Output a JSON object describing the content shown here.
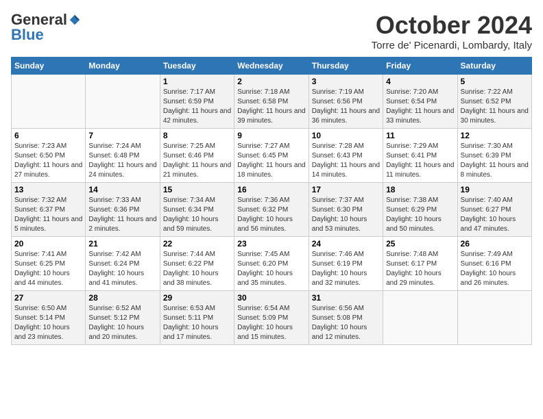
{
  "logo": {
    "general": "General",
    "blue": "Blue"
  },
  "header": {
    "month": "October 2024",
    "location": "Torre de' Picenardi, Lombardy, Italy"
  },
  "weekdays": [
    "Sunday",
    "Monday",
    "Tuesday",
    "Wednesday",
    "Thursday",
    "Friday",
    "Saturday"
  ],
  "weeks": [
    [
      {
        "day": "",
        "info": ""
      },
      {
        "day": "",
        "info": ""
      },
      {
        "day": "1",
        "info": "Sunrise: 7:17 AM\nSunset: 6:59 PM\nDaylight: 11 hours and 42 minutes."
      },
      {
        "day": "2",
        "info": "Sunrise: 7:18 AM\nSunset: 6:58 PM\nDaylight: 11 hours and 39 minutes."
      },
      {
        "day": "3",
        "info": "Sunrise: 7:19 AM\nSunset: 6:56 PM\nDaylight: 11 hours and 36 minutes."
      },
      {
        "day": "4",
        "info": "Sunrise: 7:20 AM\nSunset: 6:54 PM\nDaylight: 11 hours and 33 minutes."
      },
      {
        "day": "5",
        "info": "Sunrise: 7:22 AM\nSunset: 6:52 PM\nDaylight: 11 hours and 30 minutes."
      }
    ],
    [
      {
        "day": "6",
        "info": "Sunrise: 7:23 AM\nSunset: 6:50 PM\nDaylight: 11 hours and 27 minutes."
      },
      {
        "day": "7",
        "info": "Sunrise: 7:24 AM\nSunset: 6:48 PM\nDaylight: 11 hours and 24 minutes."
      },
      {
        "day": "8",
        "info": "Sunrise: 7:25 AM\nSunset: 6:46 PM\nDaylight: 11 hours and 21 minutes."
      },
      {
        "day": "9",
        "info": "Sunrise: 7:27 AM\nSunset: 6:45 PM\nDaylight: 11 hours and 18 minutes."
      },
      {
        "day": "10",
        "info": "Sunrise: 7:28 AM\nSunset: 6:43 PM\nDaylight: 11 hours and 14 minutes."
      },
      {
        "day": "11",
        "info": "Sunrise: 7:29 AM\nSunset: 6:41 PM\nDaylight: 11 hours and 11 minutes."
      },
      {
        "day": "12",
        "info": "Sunrise: 7:30 AM\nSunset: 6:39 PM\nDaylight: 11 hours and 8 minutes."
      }
    ],
    [
      {
        "day": "13",
        "info": "Sunrise: 7:32 AM\nSunset: 6:37 PM\nDaylight: 11 hours and 5 minutes."
      },
      {
        "day": "14",
        "info": "Sunrise: 7:33 AM\nSunset: 6:36 PM\nDaylight: 11 hours and 2 minutes."
      },
      {
        "day": "15",
        "info": "Sunrise: 7:34 AM\nSunset: 6:34 PM\nDaylight: 10 hours and 59 minutes."
      },
      {
        "day": "16",
        "info": "Sunrise: 7:36 AM\nSunset: 6:32 PM\nDaylight: 10 hours and 56 minutes."
      },
      {
        "day": "17",
        "info": "Sunrise: 7:37 AM\nSunset: 6:30 PM\nDaylight: 10 hours and 53 minutes."
      },
      {
        "day": "18",
        "info": "Sunrise: 7:38 AM\nSunset: 6:29 PM\nDaylight: 10 hours and 50 minutes."
      },
      {
        "day": "19",
        "info": "Sunrise: 7:40 AM\nSunset: 6:27 PM\nDaylight: 10 hours and 47 minutes."
      }
    ],
    [
      {
        "day": "20",
        "info": "Sunrise: 7:41 AM\nSunset: 6:25 PM\nDaylight: 10 hours and 44 minutes."
      },
      {
        "day": "21",
        "info": "Sunrise: 7:42 AM\nSunset: 6:24 PM\nDaylight: 10 hours and 41 minutes."
      },
      {
        "day": "22",
        "info": "Sunrise: 7:44 AM\nSunset: 6:22 PM\nDaylight: 10 hours and 38 minutes."
      },
      {
        "day": "23",
        "info": "Sunrise: 7:45 AM\nSunset: 6:20 PM\nDaylight: 10 hours and 35 minutes."
      },
      {
        "day": "24",
        "info": "Sunrise: 7:46 AM\nSunset: 6:19 PM\nDaylight: 10 hours and 32 minutes."
      },
      {
        "day": "25",
        "info": "Sunrise: 7:48 AM\nSunset: 6:17 PM\nDaylight: 10 hours and 29 minutes."
      },
      {
        "day": "26",
        "info": "Sunrise: 7:49 AM\nSunset: 6:16 PM\nDaylight: 10 hours and 26 minutes."
      }
    ],
    [
      {
        "day": "27",
        "info": "Sunrise: 6:50 AM\nSunset: 5:14 PM\nDaylight: 10 hours and 23 minutes."
      },
      {
        "day": "28",
        "info": "Sunrise: 6:52 AM\nSunset: 5:12 PM\nDaylight: 10 hours and 20 minutes."
      },
      {
        "day": "29",
        "info": "Sunrise: 6:53 AM\nSunset: 5:11 PM\nDaylight: 10 hours and 17 minutes."
      },
      {
        "day": "30",
        "info": "Sunrise: 6:54 AM\nSunset: 5:09 PM\nDaylight: 10 hours and 15 minutes."
      },
      {
        "day": "31",
        "info": "Sunrise: 6:56 AM\nSunset: 5:08 PM\nDaylight: 10 hours and 12 minutes."
      },
      {
        "day": "",
        "info": ""
      },
      {
        "day": "",
        "info": ""
      }
    ]
  ]
}
